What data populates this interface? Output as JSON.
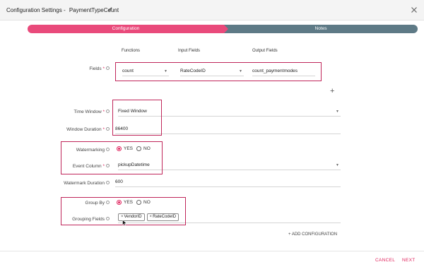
{
  "header": {
    "title_prefix": "Configuration Settings -",
    "title_name": "PaymentTypeCount"
  },
  "steps": {
    "configuration": "Configuration",
    "notes": "Notes"
  },
  "columns": {
    "functions": "Functions",
    "input_fields": "Input Fields",
    "output_fields": "Output Fields"
  },
  "fields_row": {
    "label": "Fields",
    "function": "count",
    "input": "RateCodeID",
    "output": "count_paymentmodes"
  },
  "time_window": {
    "label": "Time Window",
    "value": "Fixed Window"
  },
  "window_duration": {
    "label": "Window Duration",
    "value": "86400"
  },
  "watermarking": {
    "label": "Watermarking",
    "yes": "YES",
    "no": "NO",
    "selected": "YES"
  },
  "event_column": {
    "label": "Event Column",
    "value": "pickupDatetime"
  },
  "watermark_duration": {
    "label": "Watermark Duration",
    "value": "600"
  },
  "group_by": {
    "label": "Group By",
    "yes": "YES",
    "no": "NO",
    "selected": "YES"
  },
  "grouping_fields": {
    "label": "Grouping Fields",
    "chips": [
      "VendorID",
      "RateCodeID"
    ]
  },
  "add_configuration": "+ ADD CONFIGURATION",
  "footer": {
    "cancel": "CANCEL",
    "next": "NEXT"
  },
  "colors": {
    "accent": "#e94a7b",
    "notes_step": "#5e7a86",
    "highlight": "#c0265a"
  }
}
